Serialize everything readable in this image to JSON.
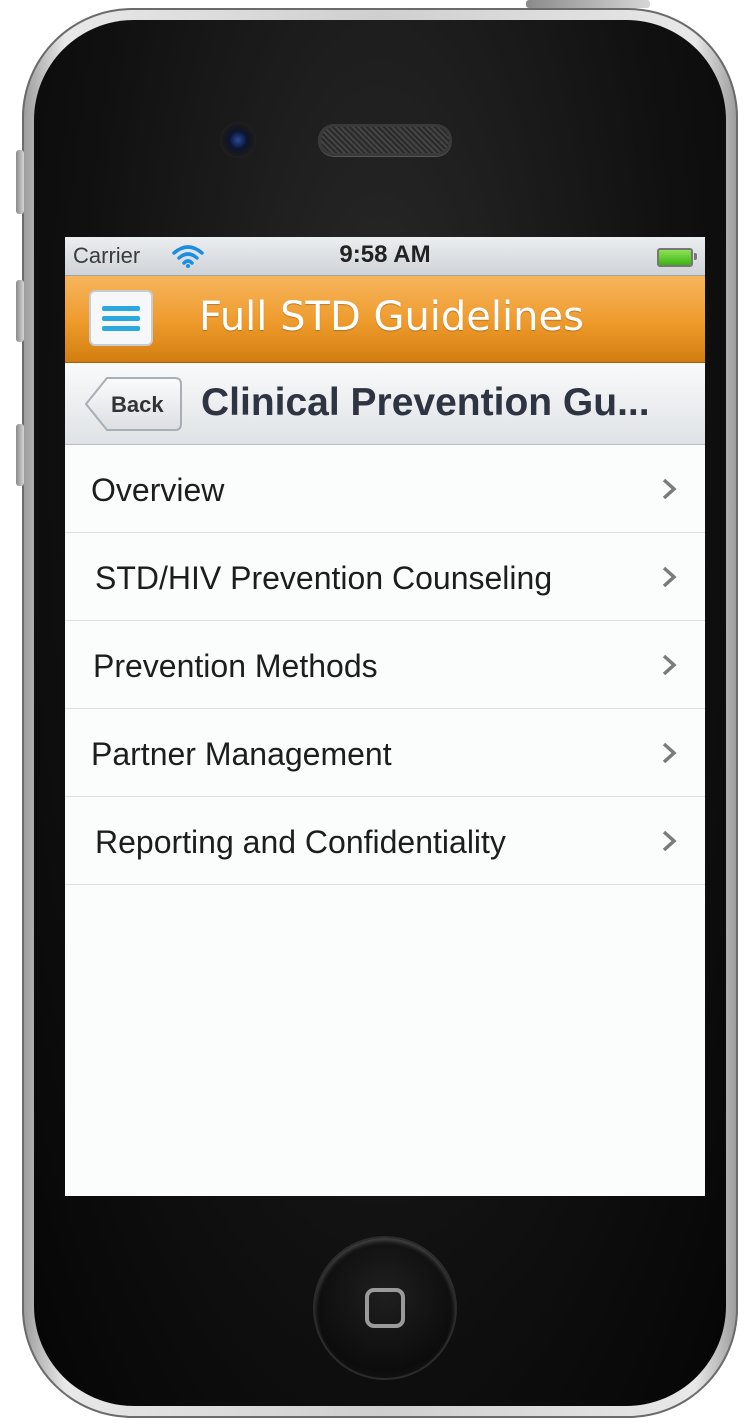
{
  "status_bar": {
    "carrier": "Carrier",
    "time": "9:58 AM",
    "wifi_icon": "wifi-icon",
    "battery_icon": "battery-icon"
  },
  "app_header": {
    "title": "Full STD Guidelines",
    "menu_icon": "hamburger-menu-icon",
    "color": "#ee9a2b"
  },
  "nav_bar": {
    "back_label": "Back",
    "title": "Clinical Prevention Gu..."
  },
  "menu": {
    "items": [
      {
        "label": "Overview"
      },
      {
        "label": "STD/HIV Prevention Counseling"
      },
      {
        "label": "Prevention Methods"
      },
      {
        "label": "Partner Management"
      },
      {
        "label": "Reporting and Confidentiality"
      }
    ],
    "chevron_icon": "chevron-right-icon"
  }
}
